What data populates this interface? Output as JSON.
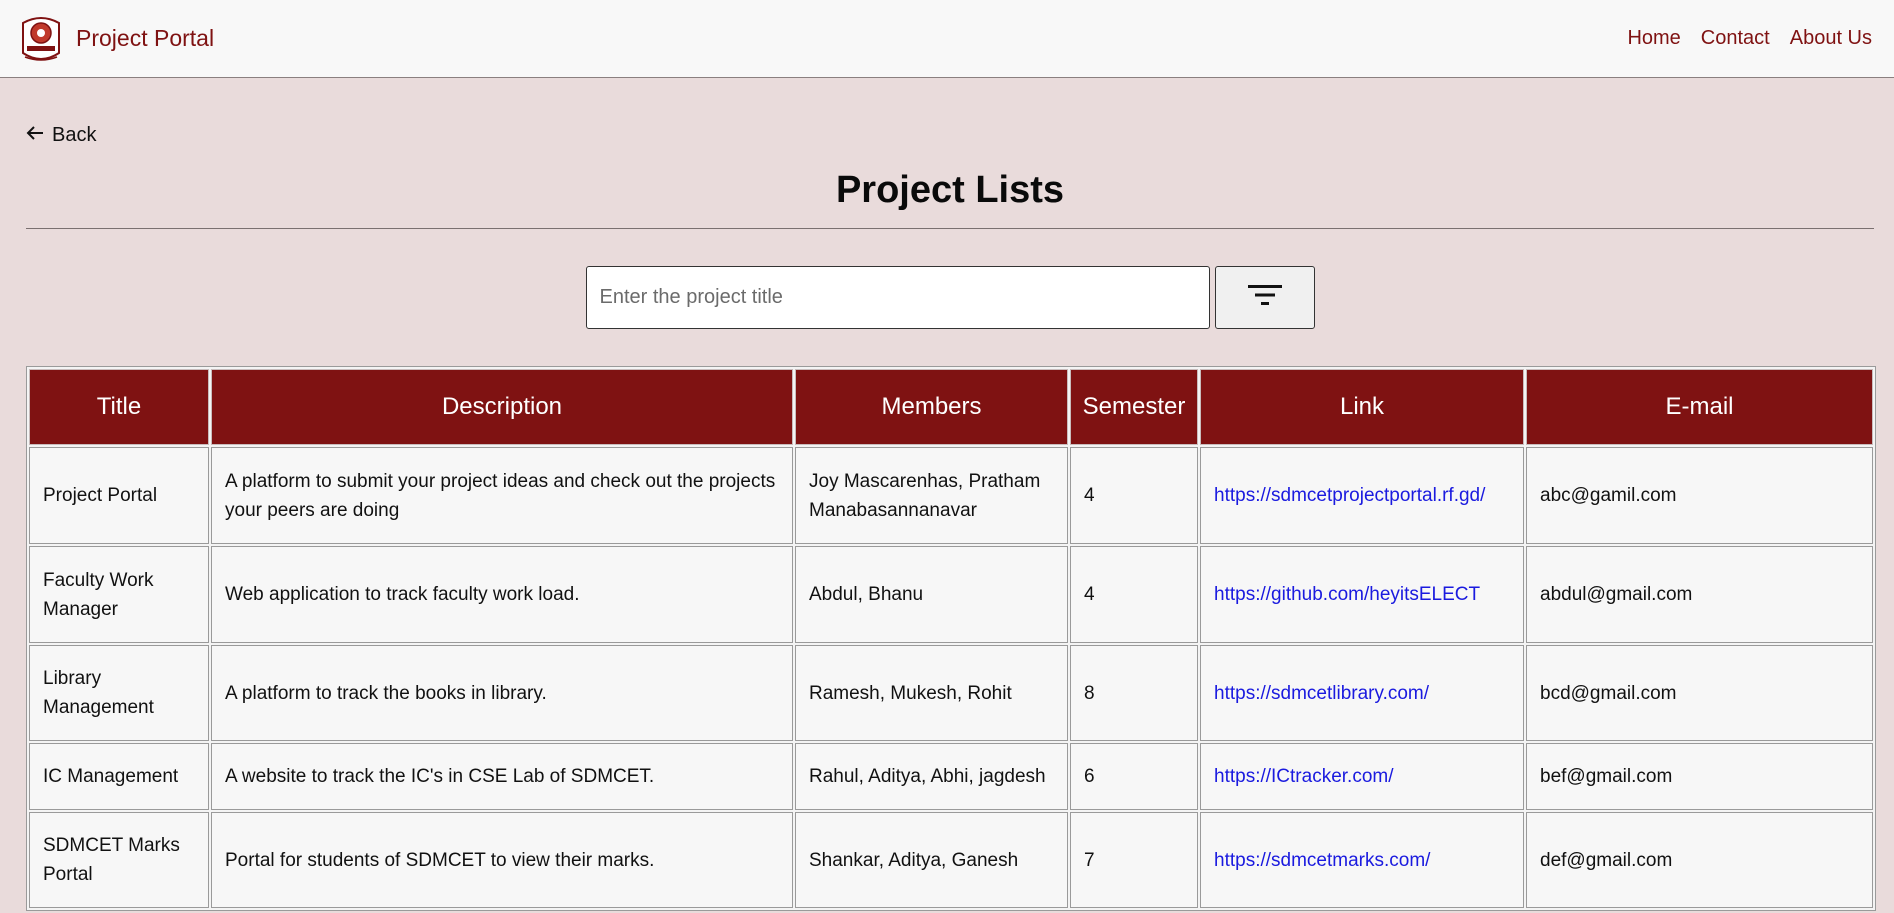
{
  "header": {
    "brand": "Project Portal",
    "nav": [
      "Home",
      "Contact",
      "About Us"
    ]
  },
  "main": {
    "back_label": "Back",
    "title": "Project Lists",
    "search": {
      "placeholder": "Enter the project title",
      "value": ""
    }
  },
  "table": {
    "columns": [
      "Title",
      "Description",
      "Members",
      "Semester",
      "Link",
      "E-mail"
    ],
    "rows": [
      {
        "title": "Project Portal",
        "description": "A platform to submit your project ideas and check out the projects your peers are doing",
        "members": "Joy Mascarenhas, Pratham Manabasannanavar",
        "semester": "4",
        "link": "https://sdmcetprojectportal.rf.gd/",
        "email": "abc@gamil.com"
      },
      {
        "title": "Faculty Work Manager",
        "description": "Web application to track faculty work load.",
        "members": "Abdul, Bhanu",
        "semester": "4",
        "link": "https://github.com/heyitsELECT",
        "email": "abdul@gmail.com"
      },
      {
        "title": "Library Management",
        "description": "A platform to track the books in library.",
        "members": "Ramesh, Mukesh, Rohit",
        "semester": "8",
        "link": "https://sdmcetlibrary.com/",
        "email": "bcd@gmail.com"
      },
      {
        "title": "IC Management",
        "description": "A website to track the IC's in CSE Lab of SDMCET.",
        "members": "Rahul, Aditya, Abhi, jagdesh",
        "semester": "6",
        "link": "https://ICtracker.com/",
        "email": "bef@gmail.com"
      },
      {
        "title": "SDMCET Marks Portal",
        "description": "Portal for students of SDMCET to view their marks.",
        "members": "Shankar, Aditya, Ganesh",
        "semester": "7",
        "link": "https://sdmcetmarks.com/",
        "email": "def@gmail.com"
      }
    ]
  },
  "icons": {
    "logo": "college-emblem-icon",
    "back": "arrow-left-icon",
    "filter": "filter-icon"
  },
  "colors": {
    "brand": "#7f1212",
    "page_bg": "#e9dbdb",
    "link": "#1a1adf"
  }
}
